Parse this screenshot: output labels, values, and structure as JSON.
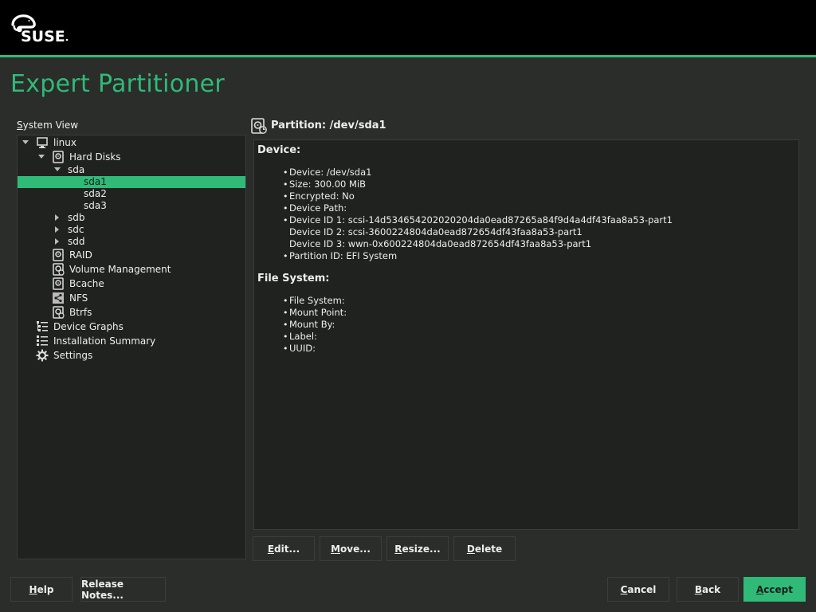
{
  "brand": {
    "logo_text": "SUSE",
    "accent": "#30ba78"
  },
  "page": {
    "title": "Expert Partitioner"
  },
  "tree": {
    "label": "System View",
    "items": [
      {
        "label": "linux",
        "icon": "computer-icon",
        "arrow": "down"
      },
      {
        "label": "Hard Disks",
        "icon": "hard-disk-icon",
        "arrow": "down"
      },
      {
        "label": "sda",
        "icon": "",
        "arrow": "down"
      },
      {
        "label": "sda1",
        "icon": "",
        "arrow": "",
        "selected": true
      },
      {
        "label": "sda2",
        "icon": "",
        "arrow": ""
      },
      {
        "label": "sda3",
        "icon": "",
        "arrow": ""
      },
      {
        "label": "sdb",
        "icon": "",
        "arrow": "right"
      },
      {
        "label": "sdc",
        "icon": "",
        "arrow": "right"
      },
      {
        "label": "sdd",
        "icon": "",
        "arrow": "right"
      },
      {
        "label": "RAID",
        "icon": "raid-icon",
        "arrow": ""
      },
      {
        "label": "Volume Management",
        "icon": "volume-management-icon",
        "arrow": ""
      },
      {
        "label": "Bcache",
        "icon": "bcache-icon",
        "arrow": ""
      },
      {
        "label": "NFS",
        "icon": "nfs-icon",
        "arrow": ""
      },
      {
        "label": "Btrfs",
        "icon": "btrfs-icon",
        "arrow": ""
      },
      {
        "label": "Device Graphs",
        "icon": "device-graphs-icon",
        "arrow": ""
      },
      {
        "label": "Installation Summary",
        "icon": "installation-summary-icon",
        "arrow": ""
      },
      {
        "label": "Settings",
        "icon": "gear-icon",
        "arrow": ""
      }
    ]
  },
  "detail": {
    "header": "Partition: /dev/sda1",
    "device_section": {
      "title": "Device:",
      "lines": [
        {
          "text": "Device: /dev/sda1",
          "bullet": true
        },
        {
          "text": "Size: 300.00 MiB",
          "bullet": true
        },
        {
          "text": "Encrypted: No",
          "bullet": true
        },
        {
          "text": "Device Path:",
          "bullet": true
        },
        {
          "text": "Device ID 1: scsi-14d534654202020204da0ead87265a84f9d4a4df43faa8a53-part1",
          "bullet": true
        },
        {
          "text": "Device ID 2: scsi-3600224804da0ead872654df43faa8a53-part1",
          "bullet": false
        },
        {
          "text": "Device ID 3: wwn-0x600224804da0ead872654df43faa8a53-part1",
          "bullet": false
        },
        {
          "text": "Partition ID: EFI System",
          "bullet": true
        }
      ]
    },
    "fs_section": {
      "title": "File System:",
      "lines": [
        {
          "text": "File System:",
          "bullet": true
        },
        {
          "text": "Mount Point:",
          "bullet": true
        },
        {
          "text": "Mount By:",
          "bullet": true
        },
        {
          "text": "Label:",
          "bullet": true
        },
        {
          "text": "UUID:",
          "bullet": true
        }
      ]
    }
  },
  "actions": {
    "edit": "Edit...",
    "move": "Move...",
    "resize": "Resize...",
    "delete": "Delete"
  },
  "footer": {
    "help": "Help",
    "release_notes": "Release Notes...",
    "cancel": "Cancel",
    "back": "Back",
    "accept": "Accept"
  }
}
